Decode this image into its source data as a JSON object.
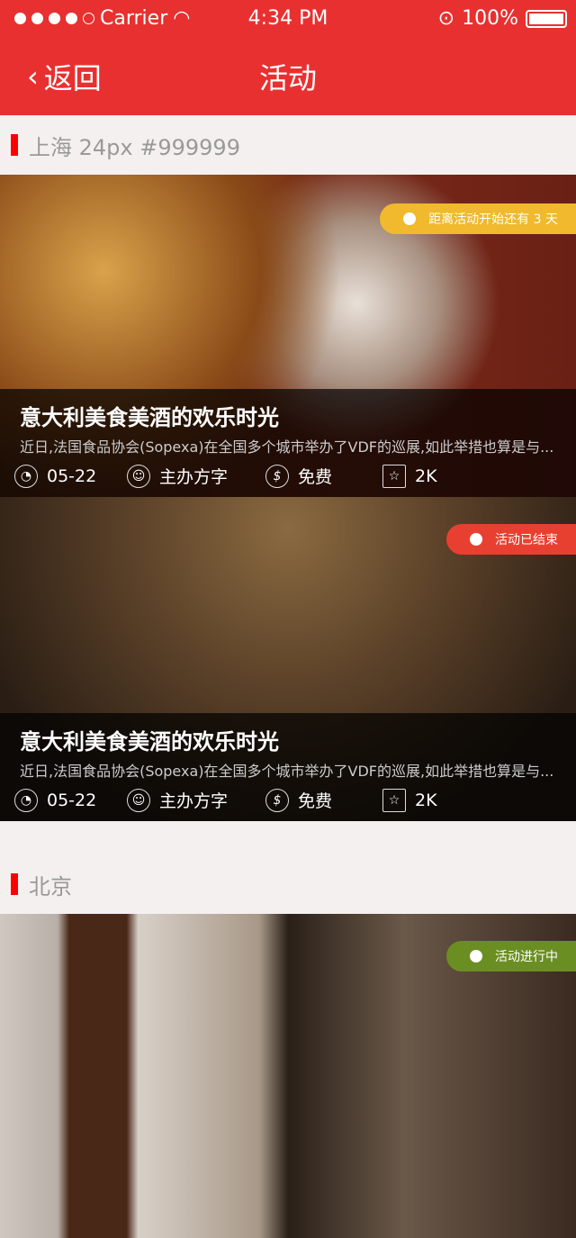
{
  "status": {
    "carrier": "Carrier",
    "time": "4:34 PM",
    "battery": "100%"
  },
  "nav": {
    "back": "返回",
    "title": "活动"
  },
  "sections": [
    {
      "title": "上海 24px #999999"
    },
    {
      "title": "北京"
    }
  ],
  "cards": [
    {
      "title": "意大利美食美酒的欢乐时光",
      "desc": "近日,法国食品协会(Sopexa)在全国多个城市举办了VDF的巡展,如此举措也算是与...",
      "date": "05-22",
      "organizer": "主办方字",
      "price": "免费",
      "favorites": "2K",
      "badge": "距离活动开始还有 3 天",
      "badge_color": "#f0b92e"
    },
    {
      "title": "意大利美食美酒的欢乐时光",
      "desc": "近日,法国食品协会(Sopexa)在全国多个城市举办了VDF的巡展,如此举措也算是与...",
      "date": "05-22",
      "organizer": "主办方字",
      "price": "免费",
      "favorites": "2K",
      "badge": "活动已结束",
      "badge_color": "#e84030"
    },
    {
      "badge": "活动进行中",
      "badge_color": "#6b8e23"
    }
  ]
}
